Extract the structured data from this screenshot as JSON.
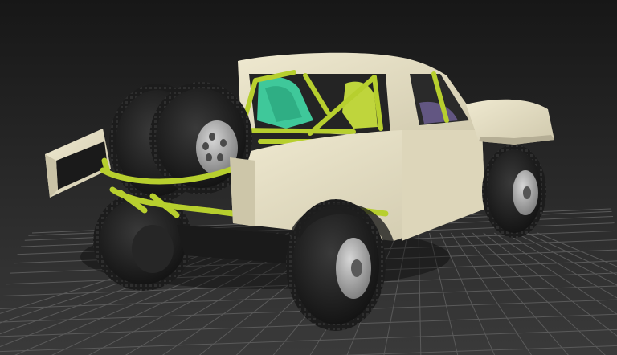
{
  "viewport": {
    "background_top": "#171717",
    "background_bottom": "#3a3a3a",
    "grid_color": "#5a5a5a",
    "grid_major_color": "#6e6e6e"
  },
  "model": {
    "body_color": "#e8e2c8",
    "body_shade_color": "#b5ae95",
    "cage_color": "#b7cf2e",
    "seat_color": "#3fc89a",
    "tire_color": "#1e1e1e",
    "rim_color": "#a4a4a4",
    "interior_color": "#2a2a2a"
  }
}
